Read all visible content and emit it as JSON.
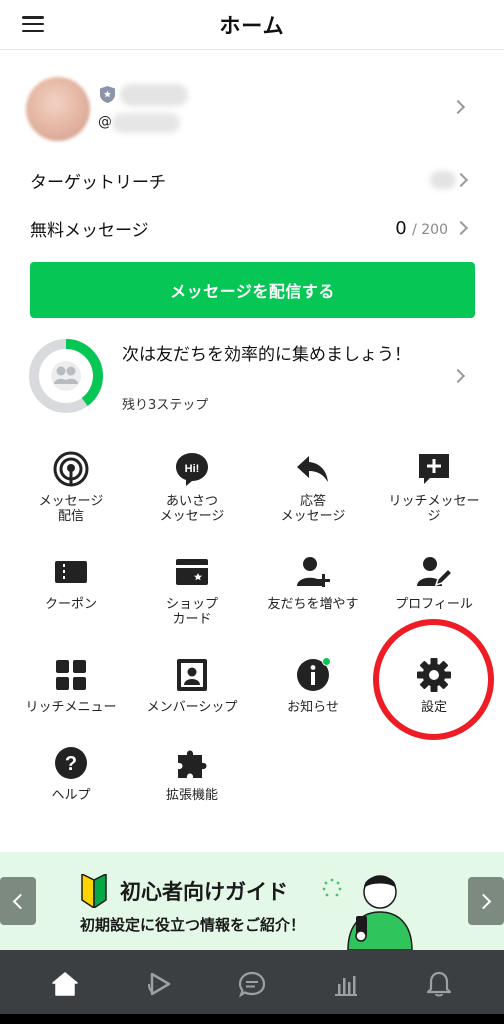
{
  "header": {
    "title": "ホーム"
  },
  "account": {
    "name_prefix": "@"
  },
  "rows": {
    "target_reach": {
      "label": "ターゲットリーチ"
    },
    "free_messages": {
      "label": "無料メッセージ",
      "used": "0",
      "limit": "/ 200"
    }
  },
  "send_button": {
    "label": "メッセージを配信する"
  },
  "steps": {
    "title": "次は友だちを効率的に集めましょう！",
    "remaining": "残り3ステップ",
    "progress_fraction": 0.4
  },
  "grid": [
    {
      "label": "メッセージ\n配信",
      "icon": "broadcast-icon"
    },
    {
      "label": "あいさつ\nメッセージ",
      "icon": "hi-bubble-icon"
    },
    {
      "label": "応答\nメッセージ",
      "icon": "reply-icon"
    },
    {
      "label": "リッチメッセー\nジ",
      "icon": "rich-message-icon"
    },
    {
      "label": "クーポン",
      "icon": "coupon-icon"
    },
    {
      "label": "ショップ\nカード",
      "icon": "shop-card-icon"
    },
    {
      "label": "友だちを増やす",
      "icon": "add-friend-icon"
    },
    {
      "label": "プロフィール",
      "icon": "profile-edit-icon"
    },
    {
      "label": "リッチメニュー",
      "icon": "rich-menu-icon"
    },
    {
      "label": "メンバーシップ",
      "icon": "membership-icon"
    },
    {
      "label": "お知らせ",
      "icon": "info-icon"
    },
    {
      "label": "設定",
      "icon": "gear-icon"
    },
    {
      "label": "ヘルプ",
      "icon": "help-icon"
    },
    {
      "label": "拡張機能",
      "icon": "puzzle-icon"
    }
  ],
  "banner": {
    "title": "初心者向けガイド",
    "subtitle": "初期設定に役立つ情報をご紹介！"
  },
  "bottom_nav": [
    "home-icon",
    "play-icon",
    "chat-icon",
    "analytics-icon",
    "bell-icon"
  ],
  "colors": {
    "brand_green": "#06c755",
    "highlight_red": "#ee1c25",
    "nav_bg": "#3c3f41",
    "banner_bg": "#e4f8e8"
  }
}
